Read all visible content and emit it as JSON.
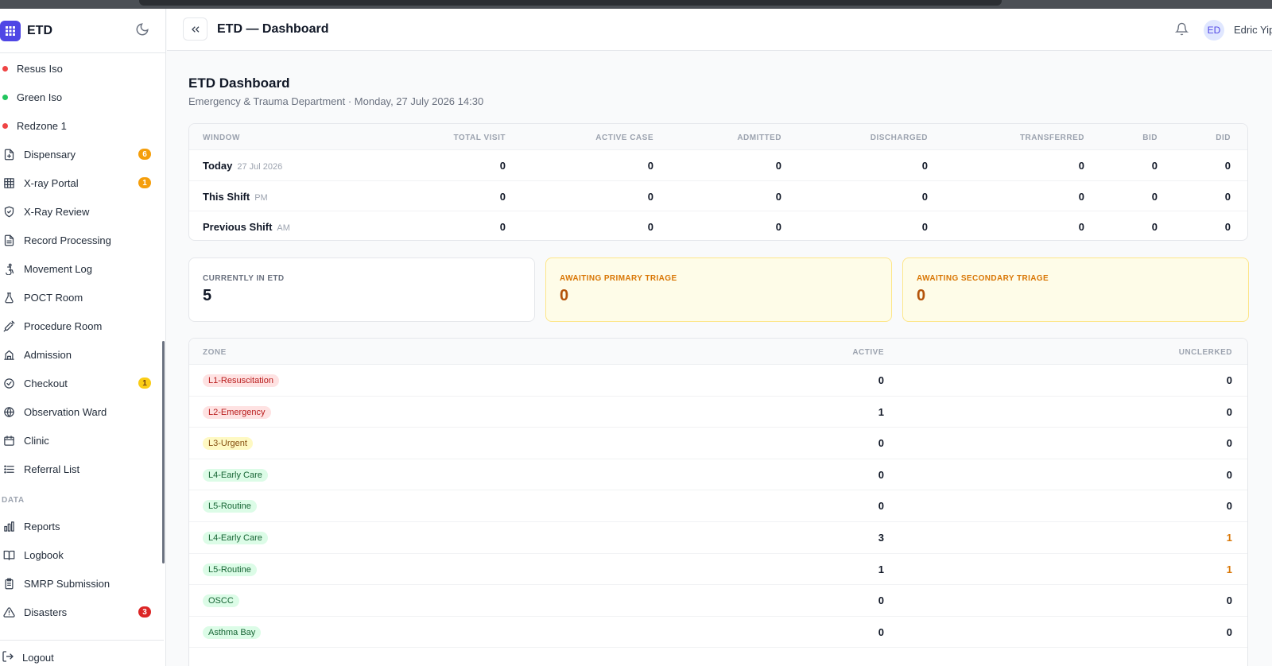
{
  "app": {
    "name": "ETD"
  },
  "header": {
    "title": "ETD — Dashboard",
    "user_initials": "ED",
    "user_name": "Edric Yip"
  },
  "sidebar": {
    "zones": [
      {
        "label": "Resus Iso",
        "color": "#ef4444"
      },
      {
        "label": "Green Iso",
        "color": "#22c55e"
      },
      {
        "label": "Redzone 1",
        "color": "#ef4444"
      }
    ],
    "items": [
      {
        "label": "Dispensary",
        "icon": "file-plus-icon",
        "badge": "6",
        "badge_color": "#f59e0b"
      },
      {
        "label": "X-ray Portal",
        "icon": "grid-icon",
        "badge": "1",
        "badge_color": "#f59e0b"
      },
      {
        "label": "X-Ray Review",
        "icon": "shield-check-icon",
        "badge": "",
        "badge_color": ""
      },
      {
        "label": "Record Processing",
        "icon": "file-text-icon",
        "badge": "",
        "badge_color": ""
      },
      {
        "label": "Movement Log",
        "icon": "accessibility-icon",
        "badge": "",
        "badge_color": ""
      },
      {
        "label": "POCT Room",
        "icon": "flask-icon",
        "badge": "",
        "badge_color": ""
      },
      {
        "label": "Procedure Room",
        "icon": "syringe-icon",
        "badge": "",
        "badge_color": ""
      },
      {
        "label": "Admission",
        "icon": "building-icon",
        "badge": "",
        "badge_color": ""
      },
      {
        "label": "Checkout",
        "icon": "check-circle-icon",
        "badge": "1",
        "badge_color": "#facc15"
      },
      {
        "label": "Observation Ward",
        "icon": "globe-icon",
        "badge": "",
        "badge_color": ""
      },
      {
        "label": "Clinic",
        "icon": "calendar-icon",
        "badge": "",
        "badge_color": ""
      },
      {
        "label": "Referral List",
        "icon": "list-icon",
        "badge": "",
        "badge_color": ""
      }
    ],
    "data_section_label": "DATA",
    "data_items": [
      {
        "label": "Reports",
        "icon": "bar-chart-icon",
        "badge": "",
        "badge_color": ""
      },
      {
        "label": "Logbook",
        "icon": "book-icon",
        "badge": "",
        "badge_color": ""
      },
      {
        "label": "SMRP Submission",
        "icon": "clipboard-icon",
        "badge": "",
        "badge_color": ""
      },
      {
        "label": "Disasters",
        "icon": "alert-triangle-icon",
        "badge": "3",
        "badge_color": "#dc2626"
      }
    ],
    "logout_label": "Logout"
  },
  "main": {
    "title": "ETD Dashboard",
    "subtitle": "Emergency & Trauma Department · Monday, 27 July 2026 14:30",
    "window_table": {
      "columns": [
        "WINDOW",
        "TOTAL VISIT",
        "ACTIVE CASE",
        "ADMITTED",
        "DISCHARGED",
        "TRANSFERRED",
        "BID",
        "DID"
      ],
      "rows": [
        {
          "label": "Today",
          "sub": "27 Jul 2026",
          "values": [
            "0",
            "0",
            "0",
            "0",
            "0",
            "0",
            "0"
          ]
        },
        {
          "label": "This Shift",
          "sub": "PM",
          "values": [
            "0",
            "0",
            "0",
            "0",
            "0",
            "0",
            "0"
          ]
        },
        {
          "label": "Previous Shift",
          "sub": "AM",
          "values": [
            "0",
            "0",
            "0",
            "0",
            "0",
            "0",
            "0"
          ]
        }
      ]
    },
    "stats": [
      {
        "label": "CURRENTLY IN ETD",
        "value": "5",
        "bg": "#ffffff",
        "border": "#e5e7eb",
        "label_color": "#6b7280",
        "value_color": "#111827"
      },
      {
        "label": "AWAITING PRIMARY TRIAGE",
        "value": "0",
        "bg": "#fefce8",
        "border": "#fde68a",
        "label_color": "#d97706",
        "value_color": "#b45309"
      },
      {
        "label": "AWAITING SECONDARY TRIAGE",
        "value": "0",
        "bg": "#fefce8",
        "border": "#fde68a",
        "label_color": "#d97706",
        "value_color": "#b45309"
      }
    ],
    "zone_table": {
      "columns": [
        "ZONE",
        "ACTIVE",
        "UNCLERKED"
      ],
      "rows": [
        {
          "zone": "L1-Resuscitation",
          "active": "0",
          "unclerked": "0",
          "bg": "#fee2e2",
          "fg": "#b91c1c",
          "unclerked_color": "#111827"
        },
        {
          "zone": "L2-Emergency",
          "active": "1",
          "unclerked": "0",
          "bg": "#fee2e2",
          "fg": "#b91c1c",
          "unclerked_color": "#111827"
        },
        {
          "zone": "L3-Urgent",
          "active": "0",
          "unclerked": "0",
          "bg": "#fef9c3",
          "fg": "#854d0e",
          "unclerked_color": "#111827"
        },
        {
          "zone": "L4-Early Care",
          "active": "0",
          "unclerked": "0",
          "bg": "#dcfce7",
          "fg": "#166534",
          "unclerked_color": "#111827"
        },
        {
          "zone": "L5-Routine",
          "active": "0",
          "unclerked": "0",
          "bg": "#dcfce7",
          "fg": "#166534",
          "unclerked_color": "#111827"
        },
        {
          "zone": "L4-Early Care",
          "active": "3",
          "unclerked": "1",
          "bg": "#dcfce7",
          "fg": "#166534",
          "unclerked_color": "#d97706"
        },
        {
          "zone": "L5-Routine",
          "active": "1",
          "unclerked": "1",
          "bg": "#dcfce7",
          "fg": "#166534",
          "unclerked_color": "#d97706"
        },
        {
          "zone": "OSCC",
          "active": "0",
          "unclerked": "0",
          "bg": "#dcfce7",
          "fg": "#166534",
          "unclerked_color": "#111827"
        },
        {
          "zone": "Asthma Bay",
          "active": "0",
          "unclerked": "0",
          "bg": "#dcfce7",
          "fg": "#166534",
          "unclerked_color": "#111827"
        }
      ]
    }
  }
}
